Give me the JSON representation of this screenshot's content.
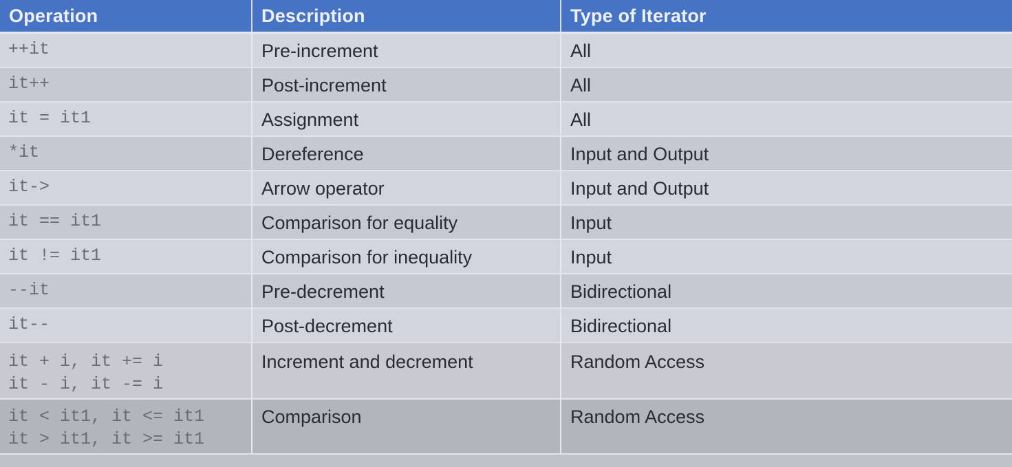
{
  "table": {
    "headers": [
      "Operation",
      "Description",
      "Type of Iterator"
    ],
    "rows": [
      {
        "operation": [
          "++it"
        ],
        "description": "Pre-increment",
        "type": "All"
      },
      {
        "operation": [
          "it++"
        ],
        "description": "Post-increment",
        "type": "All"
      },
      {
        "operation": [
          "it = it1"
        ],
        "description": "Assignment",
        "type": "All"
      },
      {
        "operation": [
          "*it"
        ],
        "description": "Dereference",
        "type": "Input and Output"
      },
      {
        "operation": [
          "it->"
        ],
        "description": "Arrow operator",
        "type": "Input and Output"
      },
      {
        "operation": [
          "it == it1"
        ],
        "description": "Comparison for equality",
        "type": "Input"
      },
      {
        "operation": [
          "it != it1"
        ],
        "description": "Comparison for inequality",
        "type": "Input"
      },
      {
        "operation": [
          "--it"
        ],
        "description": "Pre-decrement",
        "type": "Bidirectional"
      },
      {
        "operation": [
          "it--"
        ],
        "description": "Post-decrement",
        "type": "Bidirectional"
      },
      {
        "operation": [
          "it + i, it += i",
          "it - i, it -= i"
        ],
        "description": "Increment and decrement",
        "type": "Random Access"
      },
      {
        "operation": [
          "it < it1, it <= it1",
          "it > it1, it >= it1"
        ],
        "description": "Comparison",
        "type": "Random Access"
      }
    ]
  },
  "colors": {
    "header_bg": "#4673c3",
    "header_text": "#eef1f8",
    "row_light": "#d2d4de",
    "row_dark": "#c7c9d2"
  }
}
